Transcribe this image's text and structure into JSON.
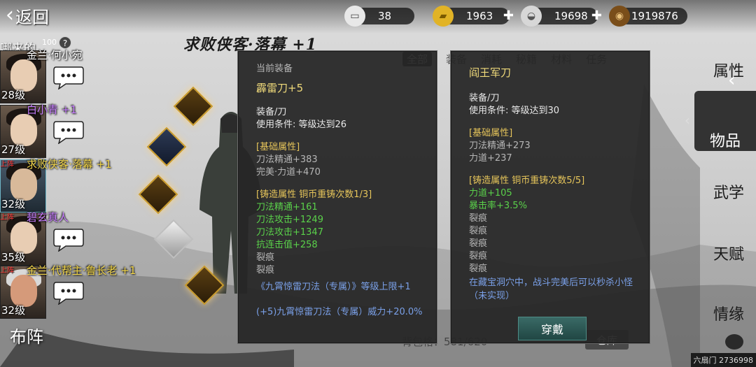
{
  "topbar": {
    "back_label": "返回",
    "resources": [
      {
        "name": "stamina",
        "icon": "cart-icon",
        "value": "38",
        "color": "#7b8b7a"
      },
      {
        "name": "gold",
        "icon": "gold-bar-icon",
        "value": "1963",
        "color": "#e1b326"
      },
      {
        "name": "silver",
        "icon": "silver-ingot-icon",
        "value": "19698",
        "color": "#c9c9c9"
      },
      {
        "name": "copper",
        "icon": "coin-icon",
        "value": "1919876",
        "color": "#9a6a2a"
      }
    ]
  },
  "roster": {
    "header": "哪来的",
    "badge": "100",
    "members": [
      {
        "name": "金兰·何小宛",
        "name_color": "#ffffff",
        "level": "28级",
        "tag": ""
      },
      {
        "name": "白小青 +1",
        "name_color": "#c77dff",
        "level": "27级",
        "tag": ""
      },
      {
        "name": "求败侠客·落幕 +1",
        "name_color": "#f2d64b",
        "level": "32级",
        "tag": "上阵"
      },
      {
        "name": "碧玄真人",
        "name_color": "#c77dff",
        "level": "35级",
        "tag": "上阵"
      },
      {
        "name": "金兰·代帮主·鲁长老 +1",
        "name_color": "#f2d64b",
        "level": "32级",
        "tag": "上阵"
      }
    ],
    "formation_label": "布阵"
  },
  "main": {
    "page_title": "求败侠客·落幕 +1",
    "tabs": [
      "全部",
      "装备",
      "消耗",
      "秘籍",
      "材料",
      "任务"
    ],
    "active_tab": "全部",
    "bag_count": "背包格：581/620",
    "warehouse_label": "仓库"
  },
  "current_equipment": {
    "header": "当前装备",
    "name": "霹雷刀+5",
    "type": "装备/刀",
    "requirement": "使用条件: 等级达到26",
    "base_header": "[基础属性]",
    "base_stats": [
      "刀法精通+383",
      "完美·力道+470"
    ],
    "forge_header": "[铸造属性 铜币重铸次数1/3]",
    "forge_stats": [
      "刀法精通+161",
      "刀法攻击+1249",
      "刀法攻击+1347",
      "抗连击值+258"
    ],
    "cracks": [
      "裂痕",
      "裂痕"
    ],
    "skill_bonus": "《九霄惊雷刀法（专属）》等级上限+1",
    "skill_bonus_2": "(+5)九霄惊雷刀法（专属）威力+20.0%"
  },
  "compare_equipment": {
    "name": "阎王军刀",
    "type": "装备/刀",
    "requirement": "使用条件: 等级达到30",
    "base_header": "[基础属性]",
    "base_stats": [
      "刀法精通+273",
      "力道+237"
    ],
    "forge_header": "[铸造属性 铜币重铸次数5/5]",
    "forge_stats": [
      "力道+105",
      "暴击率+3.5%"
    ],
    "cracks": [
      "裂痕",
      "裂痕",
      "裂痕",
      "裂痕",
      "裂痕"
    ],
    "description": "在藏宝洞穴中，战斗完美后可以秒杀小怪（未实现）",
    "wear_label": "穿戴"
  },
  "side_menu": {
    "items": [
      "属性",
      "物品",
      "武学",
      "天赋",
      "情缘"
    ],
    "active": "物品"
  },
  "footer": {
    "credit": "六扇门 2736998"
  }
}
